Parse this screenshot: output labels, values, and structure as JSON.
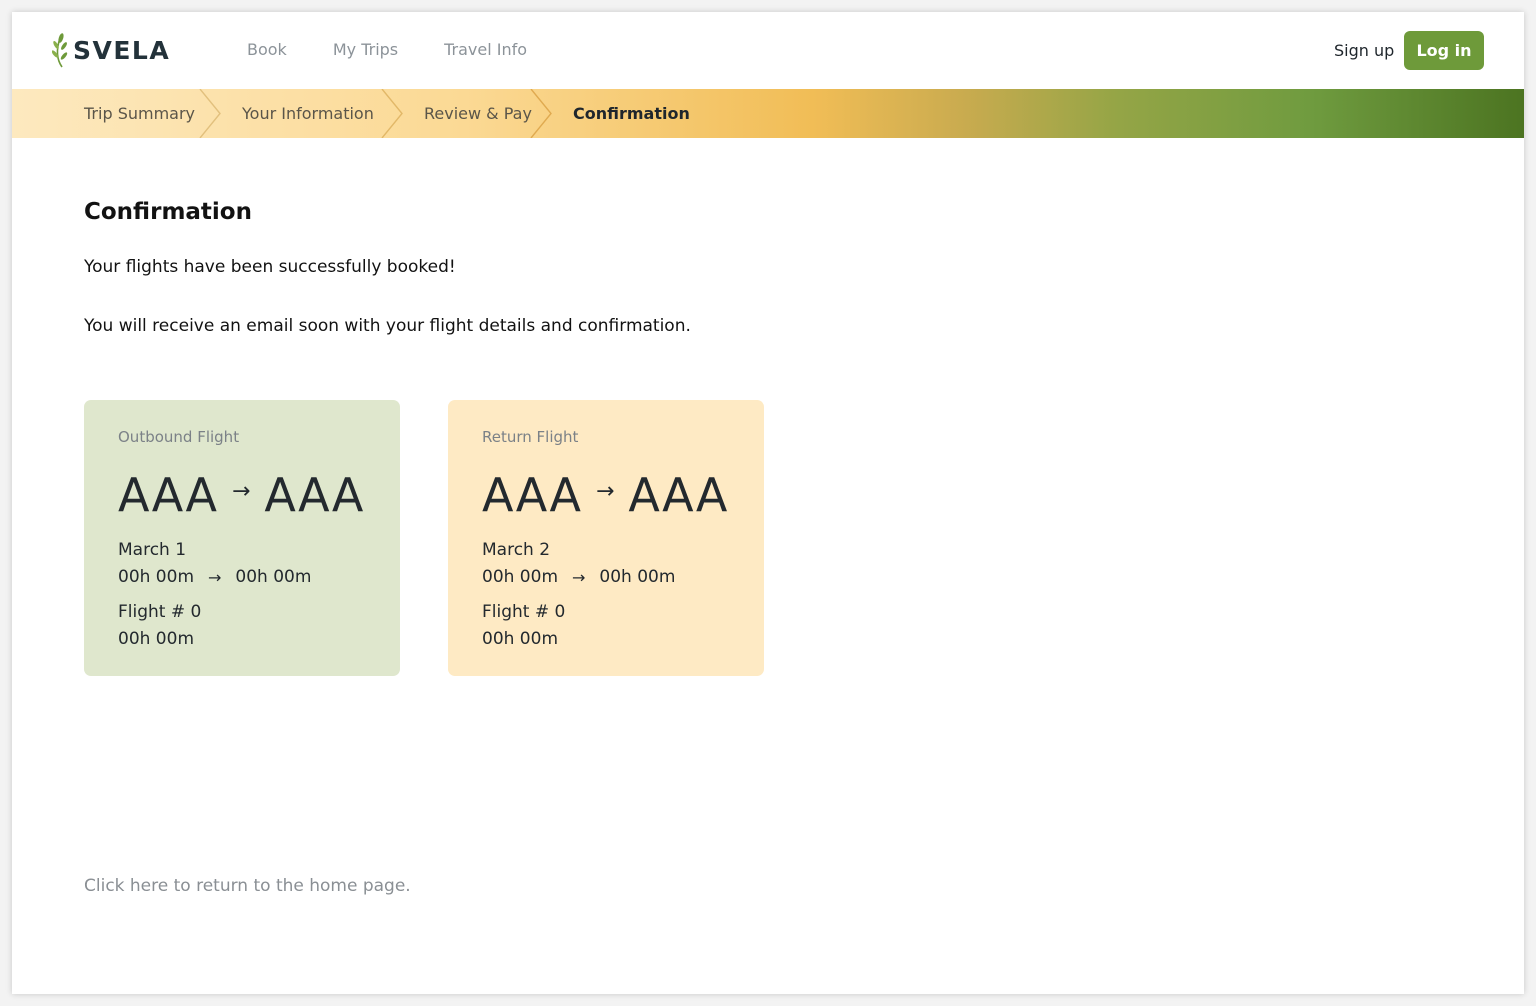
{
  "brand": {
    "name": "SVELA",
    "accent": "#6e9a3a"
  },
  "nav": {
    "items": [
      "Book",
      "My Trips",
      "Travel Info"
    ]
  },
  "auth": {
    "signup": "Sign up",
    "login": "Log in"
  },
  "steps": [
    {
      "label": "Trip Summary",
      "active": false
    },
    {
      "label": "Your Information",
      "active": false
    },
    {
      "label": "Review & Pay",
      "active": false
    },
    {
      "label": "Confirmation",
      "active": true
    }
  ],
  "page": {
    "title": "Confirmation",
    "message1": "Your flights have been successfully booked!",
    "message2": "You will receive an email soon with your flight details and confirmation."
  },
  "flights": [
    {
      "label": "Outbound Flight",
      "from": "AAA",
      "to": "AAA",
      "date": "March 1",
      "depart": "00h 00m",
      "arrive": "00h 00m",
      "flight_no": "Flight # 0",
      "duration": "00h 00m",
      "color": "#dfe7cd"
    },
    {
      "label": "Return Flight",
      "from": "AAA",
      "to": "AAA",
      "date": "March 2",
      "depart": "00h 00m",
      "arrive": "00h 00m",
      "flight_no": "Flight # 0",
      "duration": "00h 00m",
      "color": "#feeac4"
    }
  ],
  "footer": {
    "home_link": "Click here to return to the home page."
  }
}
